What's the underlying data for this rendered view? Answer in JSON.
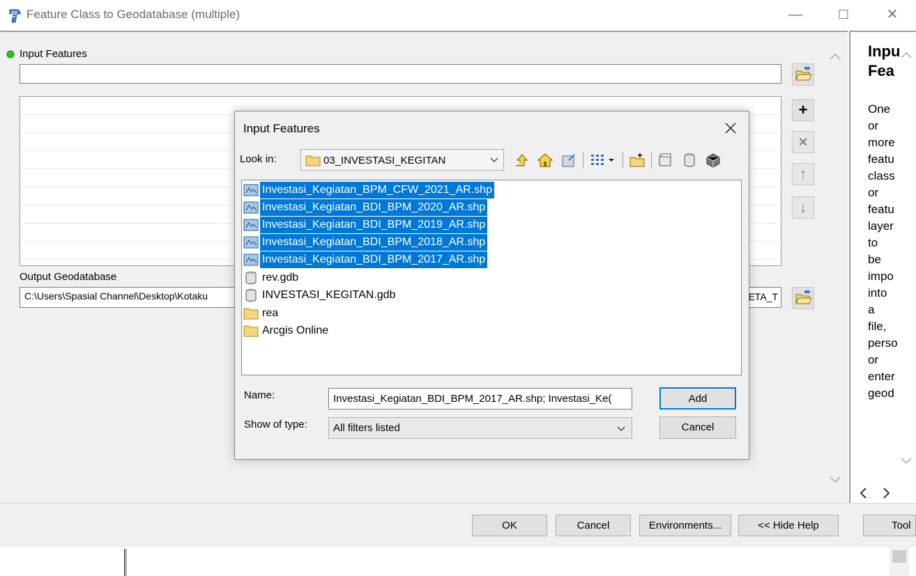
{
  "window": {
    "title": "Feature Class to Geodatabase (multiple)",
    "controls": [
      "—",
      "☐",
      "✕"
    ]
  },
  "form": {
    "input_features_label": "Input Features",
    "input_features_value": "",
    "output_gdb_label": "Output Geodatabase",
    "output_gdb_value": "C:\\Users\\Spasial Channel\\Desktop\\Kotaku",
    "output_gdb_tail": "ETA_T",
    "side_buttons": [
      "+",
      "×",
      "↑",
      "↓"
    ]
  },
  "help": {
    "title_lines": [
      "Inpu",
      "Fea"
    ],
    "text_lines": [
      "One",
      "or",
      "more",
      "featu",
      "class",
      "or",
      "featu",
      "layer",
      "to",
      "be",
      "impo",
      "into",
      "a",
      "file,",
      "perso",
      "or",
      "enter",
      "geod"
    ]
  },
  "bottom": {
    "ok": "OK",
    "cancel": "Cancel",
    "environments": "Environments...",
    "hide_help": "<< Hide Help",
    "tool": "Tool"
  },
  "dialog": {
    "title": "Input Features",
    "look_in_label": "Look in:",
    "look_in_value": "03_INVESTASI_KEGITAN",
    "files": [
      {
        "name": "Investasi_Kegiatan_BPM_CFW_2021_AR.shp",
        "type": "shapefile",
        "selected": true
      },
      {
        "name": "Investasi_Kegiatan_BDI_BPM_2020_AR.shp",
        "type": "shapefile",
        "selected": true
      },
      {
        "name": "Investasi_Kegiatan_BDI_BPM_2019_AR.shp",
        "type": "shapefile",
        "selected": true
      },
      {
        "name": "Investasi_Kegiatan_BDI_BPM_2018_AR.shp",
        "type": "shapefile",
        "selected": true
      },
      {
        "name": "Investasi_Kegiatan_BDI_BPM_2017_AR.shp",
        "type": "shapefile",
        "selected": true
      },
      {
        "name": "rev.gdb",
        "type": "geodatabase",
        "selected": false
      },
      {
        "name": "INVESTASI_KEGITAN.gdb",
        "type": "geodatabase",
        "selected": false
      },
      {
        "name": "rea",
        "type": "folder",
        "selected": false
      },
      {
        "name": "Arcgis Online",
        "type": "folder",
        "selected": false
      }
    ],
    "name_label": "Name:",
    "name_value": "Investasi_Kegiatan_BDI_BPM_2017_AR.shp; Investasi_Ke(",
    "type_label": "Show of type:",
    "type_value": "All filters listed",
    "add": "Add",
    "cancel": "Cancel",
    "colors": {
      "selection": "#0078d7",
      "folder": "#f4d77a"
    }
  }
}
